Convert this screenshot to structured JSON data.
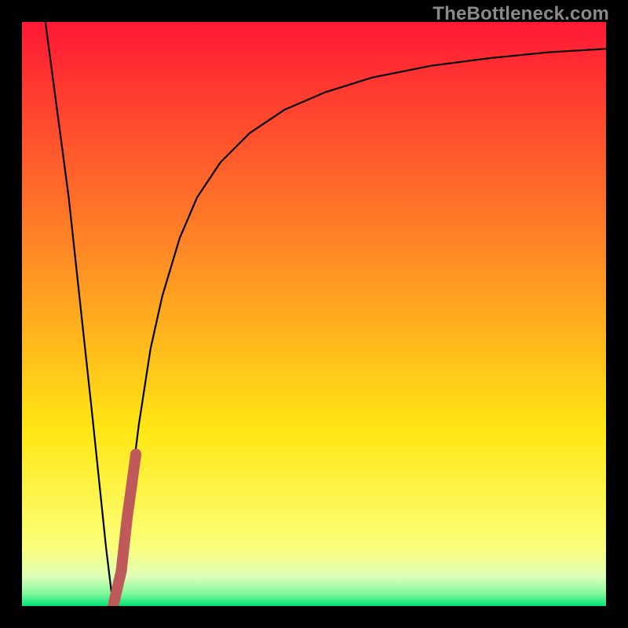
{
  "watermark": "TheBottleneck.com",
  "chart_data": {
    "type": "line",
    "title": "",
    "xlabel": "",
    "ylabel": "",
    "xlim": [
      0,
      100
    ],
    "ylim": [
      0,
      100
    ],
    "grid": false,
    "legend": false,
    "background_gradient": {
      "stops": [
        {
          "pos": 0.0,
          "color": "#ff1835"
        },
        {
          "pos": 0.4,
          "color": "#ff8b25"
        },
        {
          "pos": 0.7,
          "color": "#ffe714"
        },
        {
          "pos": 0.9,
          "color": "#fcff7a"
        },
        {
          "pos": 0.95,
          "color": "#dcffb8"
        },
        {
          "pos": 0.98,
          "color": "#7ef79a"
        },
        {
          "pos": 1.0,
          "color": "#00e47a"
        }
      ]
    },
    "series": [
      {
        "name": "bottleneck-curve",
        "type": "line",
        "color": "#000000",
        "width": 2.2,
        "x": [
          4.0,
          8.0,
          12.0,
          14.4,
          15.6,
          17.0,
          18.0,
          20.0,
          22.0,
          24.0,
          27.0,
          30.0,
          34.0,
          39.0,
          45.0,
          52.0,
          60.0,
          70.0,
          80.0,
          90.0,
          100.0
        ],
        "y": [
          100,
          70,
          33,
          10,
          0,
          6,
          15,
          31,
          44,
          53,
          63,
          70,
          76,
          81,
          85,
          88,
          90.5,
          92.5,
          93.8,
          94.8,
          95.4
        ]
      },
      {
        "name": "highlight-segment",
        "type": "line",
        "color": "#c05a5a",
        "width": 14,
        "linecap": "round",
        "x": [
          15.6,
          17.0,
          18.0,
          19.5
        ],
        "y": [
          0,
          6,
          15,
          26
        ]
      }
    ]
  }
}
